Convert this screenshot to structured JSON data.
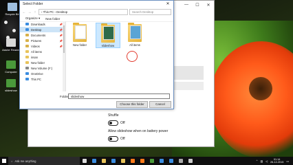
{
  "desktop": {
    "icons": [
      {
        "label": "Recycle Bin",
        "color": "#9fbfdf"
      },
      {
        "label": "Adobe Reader",
        "color": "#d8d8d8"
      },
      {
        "label": "Computer",
        "color": "#4a9a3a"
      },
      {
        "label": "slideshow",
        "color": "#4a9a3a"
      }
    ]
  },
  "settings": {
    "controls": [
      "—",
      "☐",
      "✕"
    ],
    "shuffle_label": "Shuffle",
    "shuffle_state": "Off",
    "battery_label": "Allow slideshow when on battery power",
    "battery_state": "Off"
  },
  "dialog": {
    "title": "Select Folder",
    "close": "✕",
    "address": "› This PC › Desktop",
    "search_placeholder": "Search Desktop",
    "toolbar": {
      "organize": "Organize ▾",
      "new_folder": "New folder"
    },
    "nav_items": [
      {
        "label": "Downloads",
        "pinned": true,
        "color": "#3b8de0"
      },
      {
        "label": "Desktop",
        "pinned": true,
        "selected": true,
        "color": "#3b8de0"
      },
      {
        "label": "Documents",
        "pinned": true,
        "color": "#d9b24a"
      },
      {
        "label": "Pictures",
        "pinned": true,
        "color": "#d9b24a"
      },
      {
        "label": "Videos",
        "pinned": true,
        "color": "#d9b24a"
      },
      {
        "label": "All items",
        "pinned": false,
        "color": "#e8c35a"
      },
      {
        "label": "insan",
        "pinned": false,
        "color": "#e8c35a"
      },
      {
        "label": "New folder",
        "pinned": false,
        "color": "#e8c35a"
      },
      {
        "label": "New Volume (F:)",
        "pinned": false,
        "color": "#888888"
      },
      {
        "label": "OneDrive",
        "pinned": false,
        "color": "#3b8de0"
      },
      {
        "label": "This PC",
        "pinned": false,
        "color": "#3b8de0"
      }
    ],
    "pin_glyph": "📌",
    "files": [
      {
        "label": "New folder",
        "selected": false
      },
      {
        "label": "slideshow",
        "selected": true
      },
      {
        "label": "All items",
        "selected": false
      }
    ],
    "folder_label": "Folder:",
    "folder_value": "slideshow",
    "choose_button": "Choose this folder",
    "cancel_button": "Cancel"
  },
  "taskbar": {
    "search_text": "Ask me anything",
    "apps": [
      {
        "name": "task-view",
        "color": "#dddddd"
      },
      {
        "name": "edge",
        "color": "#3b8de0"
      },
      {
        "name": "file-explorer",
        "color": "#e8c35a"
      },
      {
        "name": "store",
        "color": "#3b8de0"
      },
      {
        "name": "chrome",
        "color": "#e8c35a"
      },
      {
        "name": "firefox",
        "color": "#ff7a1a"
      },
      {
        "name": "media-player",
        "color": "#ff7a1a"
      },
      {
        "name": "photos",
        "color": "#4a9a3a"
      },
      {
        "name": "mail",
        "color": "#3b8de0"
      },
      {
        "name": "skype",
        "color": "#3b8de0"
      },
      {
        "name": "app-gray",
        "color": "#aaaaaa"
      },
      {
        "name": "settings",
        "color": "#cccccc"
      }
    ],
    "time": "01:14",
    "date": "26-12-2015"
  }
}
